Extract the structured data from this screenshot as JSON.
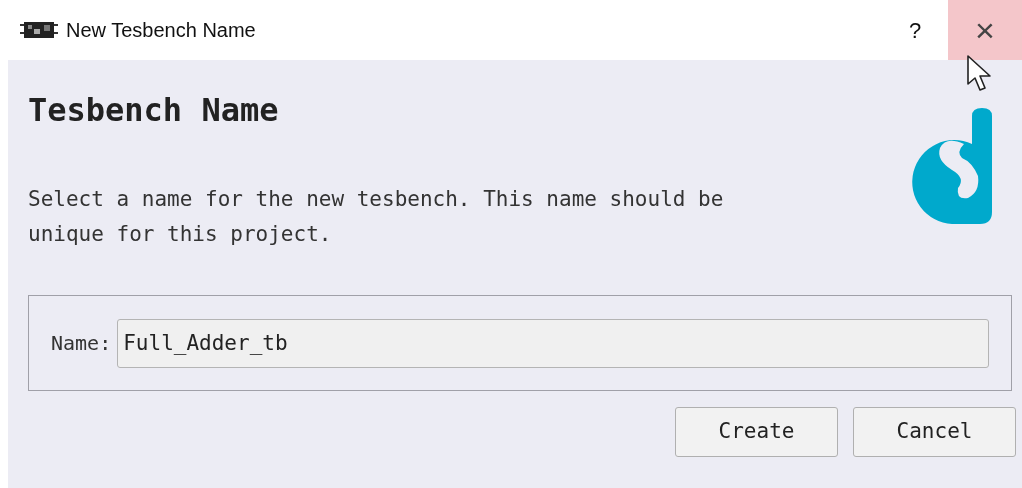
{
  "window": {
    "title": "New Tesbench Name",
    "help": "?",
    "close": "×",
    "close_hovered": true
  },
  "heading": "Tesbench Name",
  "description": "Select a name for the new tesbench. This name should be unique for this project.",
  "name_field": {
    "label": "Name:",
    "value": "Full_Adder_tb"
  },
  "buttons": [
    "Create",
    "Cancel"
  ]
}
